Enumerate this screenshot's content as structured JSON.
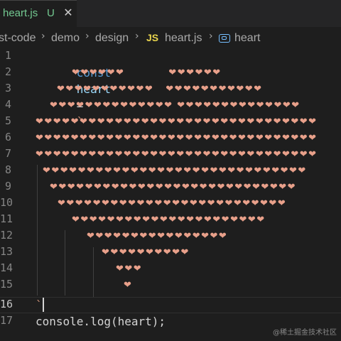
{
  "tab": {
    "label": "heart.js",
    "status": "U",
    "close": "✕"
  },
  "breadcrumb": {
    "items": [
      "st-code",
      "demo",
      "design",
      "heart.js",
      "heart"
    ],
    "js_badge": "JS",
    "separator": "›"
  },
  "code": {
    "line1": {
      "keyword": "const",
      "name": "heart",
      "op": "=",
      "tick": "`"
    },
    "heart_rows": [
      "❤❤❤❤❤❤           ❤❤❤❤❤❤",
      "❤❤❤❤❤❤❤❤❤❤❤   ❤❤❤❤❤❤❤❤❤❤❤",
      "❤❤❤❤❤❤❤❤❤❤❤❤❤❤ ❤❤❤❤❤❤❤❤❤❤❤❤❤❤",
      "❤❤❤❤❤❤❤❤❤❤❤❤❤❤❤❤❤❤❤❤❤❤❤❤❤❤❤❤❤❤❤❤",
      "❤❤❤❤❤❤❤❤❤❤❤❤❤❤❤❤❤❤❤❤❤❤❤❤❤❤❤❤❤❤❤❤",
      "❤❤❤❤❤❤❤❤❤❤❤❤❤❤❤❤❤❤❤❤❤❤❤❤❤❤❤❤❤❤❤❤",
      "❤❤❤❤❤❤❤❤❤❤❤❤❤❤❤❤❤❤❤❤❤❤❤❤❤❤❤❤❤❤",
      "❤❤❤❤❤❤❤❤❤❤❤❤❤❤❤❤❤❤❤❤❤❤❤❤❤❤❤❤",
      "❤❤❤❤❤❤❤❤❤❤❤❤❤❤❤❤❤❤❤❤❤❤❤❤❤❤",
      "❤❤❤❤❤❤❤❤❤❤❤❤❤❤❤❤❤❤❤❤❤❤",
      "❤❤❤❤❤❤❤❤❤❤❤❤❤❤❤❤",
      "❤❤❤❤❤❤❤❤❤❤",
      "❤❤❤",
      "❤"
    ],
    "line16": "`",
    "line17": "console.log(heart);"
  },
  "line_numbers": [
    "1",
    "2",
    "3",
    "4",
    "5",
    "6",
    "7",
    "8",
    "9",
    "10",
    "11",
    "12",
    "13",
    "14",
    "15",
    "16",
    "17"
  ],
  "watermark": "@稀土掘金技术社区",
  "colors": {
    "keyword": "#569cd6",
    "variable": "#9cdcfe",
    "heart": "#e8a08a",
    "untracked": "#73c991",
    "js_badge": "#e8d44d"
  }
}
